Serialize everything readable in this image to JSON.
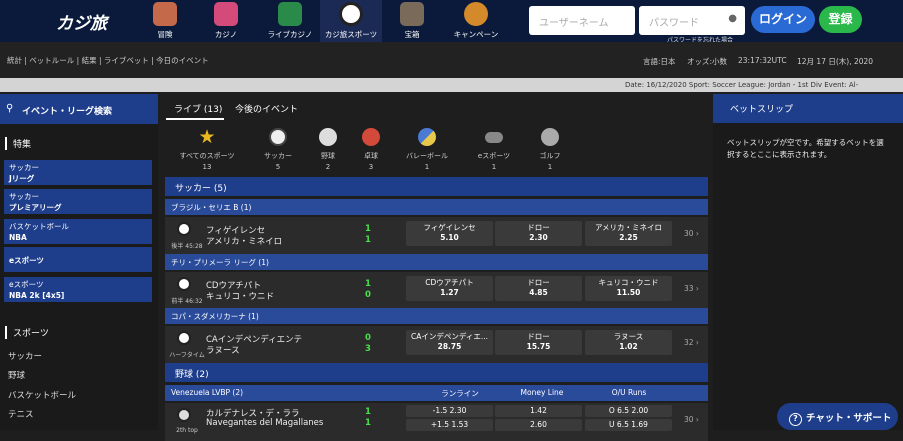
{
  "header": {
    "logo": "カジ旅",
    "nav": [
      {
        "label": "冒険",
        "icon": "adventure-map-icon",
        "color": "#c46a4a"
      },
      {
        "label": "カジノ",
        "icon": "slot-machine-icon",
        "color": "#d44a7a"
      },
      {
        "label": "ライブカジノ",
        "icon": "roulette-table-icon",
        "color": "#2a8a4a"
      },
      {
        "label": "カジ旅スポーツ",
        "icon": "soccer-ball-icon",
        "color": "#ffffff"
      },
      {
        "label": "宝箱",
        "icon": "treasure-chest-icon",
        "color": "#7a6a5a"
      },
      {
        "label": "キャンペーン",
        "icon": "campaign-badge-icon",
        "color": "#d48a2a"
      }
    ],
    "username_placeholder": "ユーザーネーム",
    "password_placeholder": "パスワード",
    "forgot_password": "パスワードを忘れた場合",
    "login_label": "ログイン",
    "register_label": "登録"
  },
  "subbar": {
    "links": "統計 | ベットルール | 結果 | ライブベット | 今日のイベント",
    "language": "言語:日本",
    "odds_format": "オッズ:小数",
    "time": "23:17:32UTC",
    "date": "12月 17 日(木), 2020"
  },
  "ticker": "Date: 16/12/2020 Sport: Soccer League: Jordan - 1st Div Event: Al-",
  "sidebar": {
    "search_label": "イベント・リーグ検索",
    "featured_title": "特集",
    "featured": [
      {
        "sport": "サッカー",
        "league": "Jリーグ"
      },
      {
        "sport": "サッカー",
        "league": "プレミアリーグ"
      },
      {
        "sport": "バスケットボール",
        "league": "NBA"
      },
      {
        "sport": "",
        "league": "eスポーツ"
      },
      {
        "sport": "eスポーツ",
        "league": "NBA 2k [4x5]"
      }
    ],
    "sports_title": "スポーツ",
    "sports": [
      "サッカー",
      "野球",
      "バスケットボール",
      "テニス"
    ]
  },
  "main": {
    "tab_live": "ライブ (13)",
    "tab_upcoming": "今後のイベント",
    "categories": [
      {
        "name": "すべてのスポーツ",
        "count": "13",
        "icon": "star-icon",
        "color": "#e8b820"
      },
      {
        "name": "サッカー",
        "count": "5",
        "icon": "soccer-ball-icon",
        "color": "#eeeeee"
      },
      {
        "name": "野球",
        "count": "2",
        "icon": "baseball-icon",
        "color": "#dddddd"
      },
      {
        "name": "卓球",
        "count": "3",
        "icon": "table-tennis-icon",
        "color": "#d44a3a"
      },
      {
        "name": "バレーボール",
        "count": "1",
        "icon": "volleyball-icon",
        "color": "#4a7ad4"
      },
      {
        "name": "eスポーツ",
        "count": "1",
        "icon": "gamepad-icon",
        "color": "#888888"
      },
      {
        "name": "ゴルフ",
        "count": "1",
        "icon": "golf-icon",
        "color": "#aaaaaa"
      }
    ],
    "soccer_header": "サッカー (5)",
    "baseball_header": "野球 (2)",
    "matches": [
      {
        "league": "ブラジル・セリエ B (1)",
        "time": "後半 45:28",
        "home": "フィゲイレンセ",
        "away": "アメリカ・ミネイロ",
        "home_score": "1",
        "away_score": "1",
        "odds": [
          {
            "label": "フィゲイレンセ",
            "value": "5.10"
          },
          {
            "label": "ドロー",
            "value": "2.30"
          },
          {
            "label": "アメリカ・ミネイロ",
            "value": "2.25"
          }
        ],
        "more": "30 ›"
      },
      {
        "league": "チリ・プリメーラ リーグ (1)",
        "time": "前半 46:32",
        "home": "CDウアチパト",
        "away": "キュリコ・ウニド",
        "home_score": "1",
        "away_score": "0",
        "odds": [
          {
            "label": "CDウアチパト",
            "value": "1.27"
          },
          {
            "label": "ドロー",
            "value": "4.85"
          },
          {
            "label": "キュリコ・ウニド",
            "value": "11.50"
          }
        ],
        "more": "33 ›"
      },
      {
        "league": "コパ・スダメリカーナ (1)",
        "time": "ハーフタイム",
        "home": "CAインデペンディエンテ",
        "away": "ラヌース",
        "home_score": "0",
        "away_score": "3",
        "odds": [
          {
            "label": "CAインデペンディエ...",
            "value": "28.75"
          },
          {
            "label": "ドロー",
            "value": "15.75"
          },
          {
            "label": "ラヌース",
            "value": "1.02"
          }
        ],
        "more": "32 ›"
      }
    ],
    "baseball": {
      "league": "Venezuela LVBP (2)",
      "col1": "ランライン",
      "col2": "Money Line",
      "col3": "O/U Runs",
      "time": "2th top",
      "home": "カルデナレス・デ・ララ",
      "away": "Navegantes del Magallanes",
      "home_score": "1",
      "away_score": "1",
      "rl1": "-1.5 2.30",
      "rl2": "+1.5 1.53",
      "ml1": "1.42",
      "ml2": "2.60",
      "ou1": "O 6.5 2.00",
      "ou2": "U 6.5 1.69",
      "more": "30 ›"
    }
  },
  "betslip": {
    "title": "ベットスリップ",
    "message": "ベットスリップが空です。希望するベットを選択するとここに表示されます。"
  },
  "chat_label": "チャット・サポート"
}
